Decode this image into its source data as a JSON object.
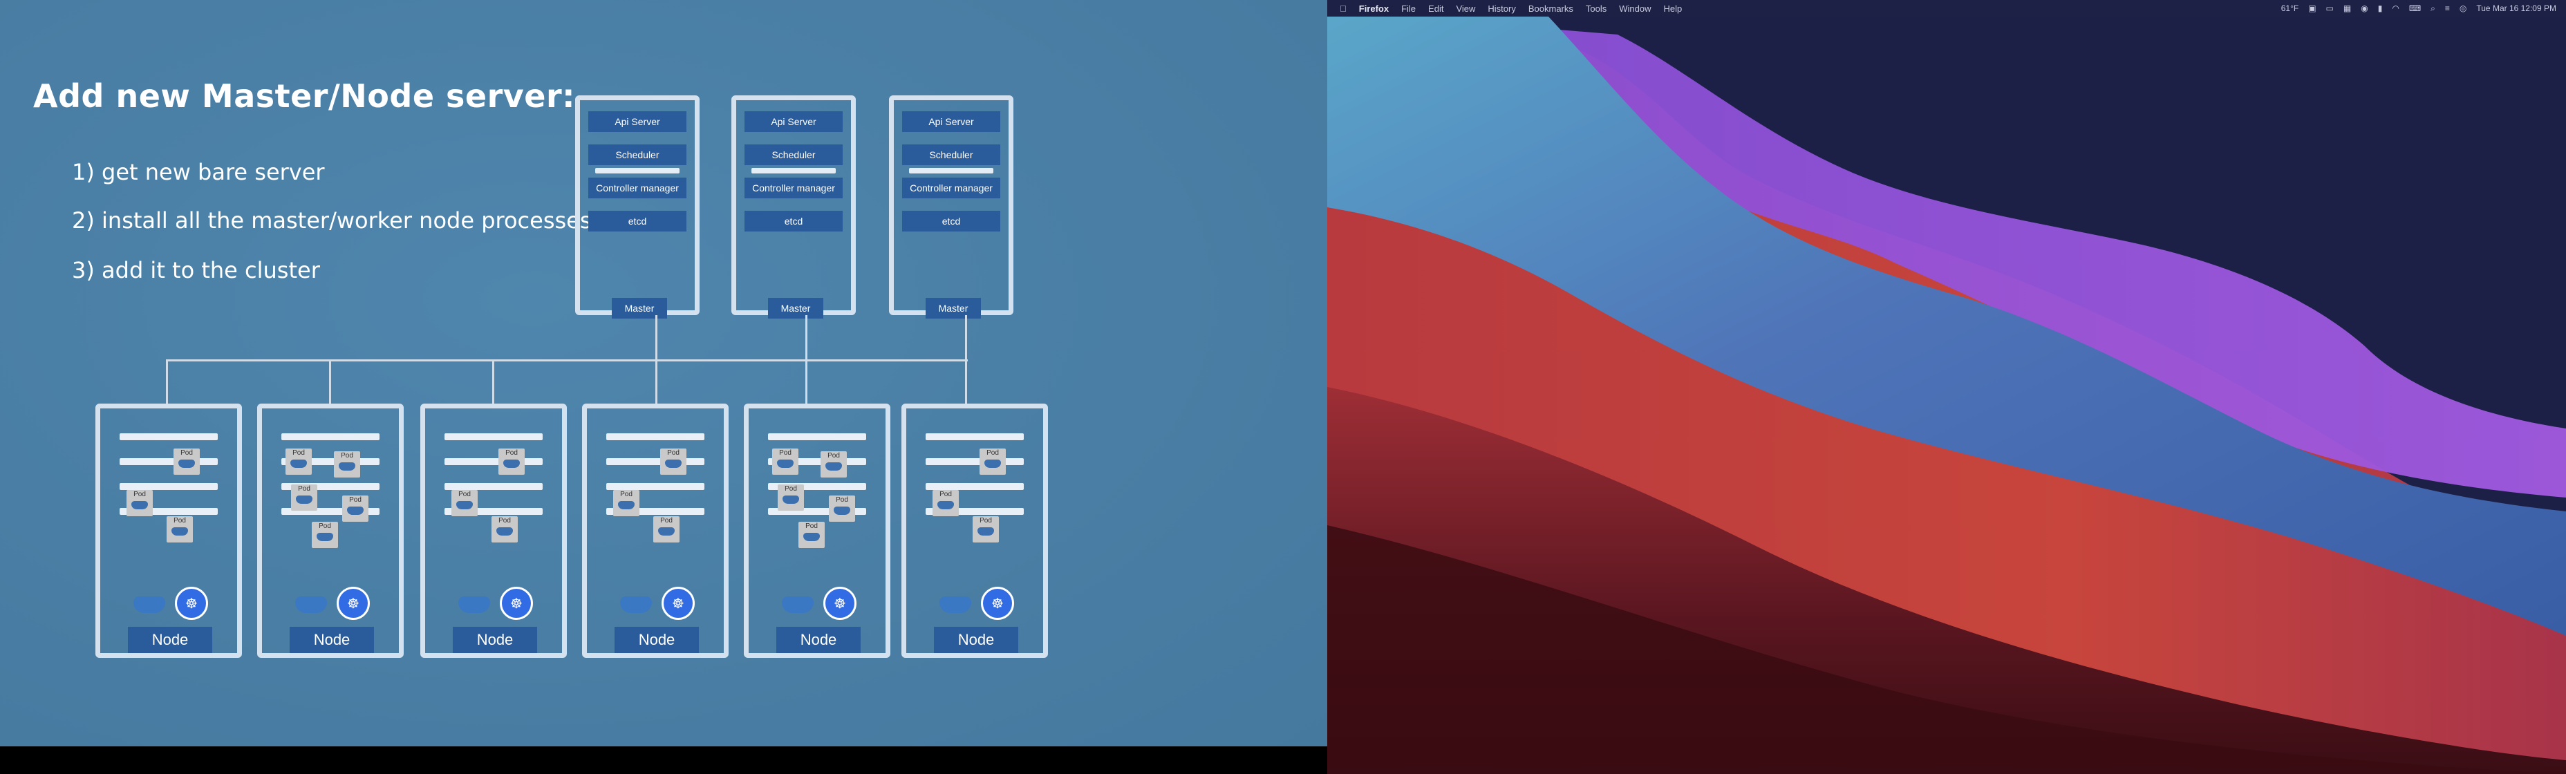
{
  "slide": {
    "title": "Add new Master/Node server:",
    "steps": [
      "1) get new bare server",
      "2) install all the master/worker node processes",
      "3) add it to the cluster"
    ],
    "master_components": [
      "Api Server",
      "Scheduler",
      "Controller manager",
      "etcd"
    ],
    "master_label": "Master",
    "node_label": "Node",
    "pod_label": "Pod"
  },
  "menubar": {
    "apple_icon": "apple-icon",
    "app_name": "Firefox",
    "menus": [
      "File",
      "Edit",
      "View",
      "History",
      "Bookmarks",
      "Tools",
      "Window",
      "Help"
    ],
    "temperature": "61°F",
    "clock": "Tue Mar 16  12:09 PM"
  },
  "colors": {
    "slide_bg": "#4a7ea4",
    "box_blue": "#2a5b9a",
    "frame": "#d4e2f0"
  }
}
